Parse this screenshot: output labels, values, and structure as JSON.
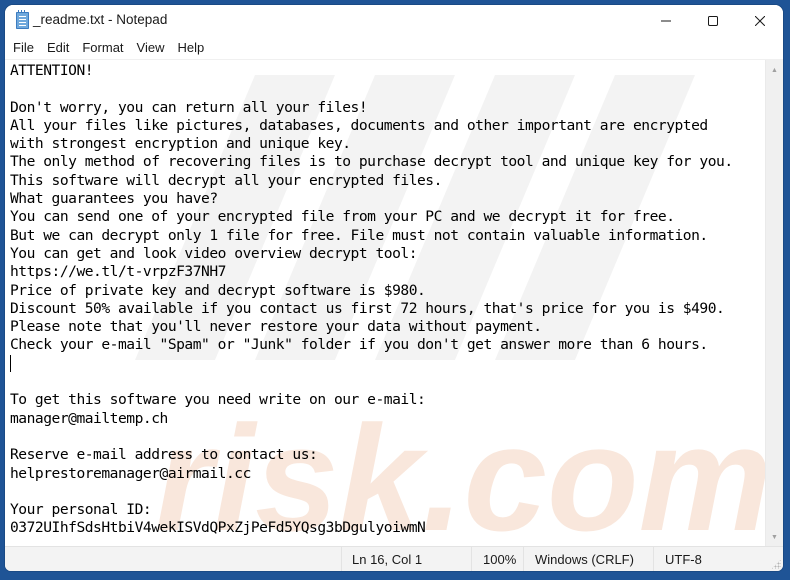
{
  "window": {
    "title": "_readme.txt - Notepad",
    "app_icon": "notepad-icon",
    "controls": {
      "minimize": "minimize-icon",
      "maximize": "maximize-icon",
      "close": "close-icon"
    }
  },
  "menu": {
    "items": [
      {
        "label": "File"
      },
      {
        "label": "Edit"
      },
      {
        "label": "Format"
      },
      {
        "label": "View"
      },
      {
        "label": "Help"
      }
    ]
  },
  "document": {
    "lines": [
      "ATTENTION!",
      "",
      "Don't worry, you can return all your files!",
      "All your files like pictures, databases, documents and other important are encrypted",
      "with strongest encryption and unique key.",
      "The only method of recovering files is to purchase decrypt tool and unique key for you.",
      "This software will decrypt all your encrypted files.",
      "What guarantees you have?",
      "You can send one of your encrypted file from your PC and we decrypt it for free.",
      "But we can decrypt only 1 file for free. File must not contain valuable information.",
      "You can get and look video overview decrypt tool:",
      "https://we.tl/t-vrpzF37NH7",
      "Price of private key and decrypt software is $980.",
      "Discount 50% available if you contact us first 72 hours, that's price for you is $490.",
      "Please note that you'll never restore your data without payment.",
      "Check your e-mail \"Spam\" or \"Junk\" folder if you don't get answer more than 6 hours.",
      "",
      "",
      "To get this software you need write on our e-mail:",
      "manager@mailtemp.ch",
      "",
      "Reserve e-mail address to contact us:",
      "helprestoremanager@airmail.cc",
      "",
      "Your personal ID:",
      "0372UIhfSdsHtbiV4wekISVdQPxZjPeFd5YQsg3bDgulyoiwmN"
    ],
    "caret_line": 16,
    "watermark": "risk.com"
  },
  "statusbar": {
    "position": "Ln 16, Col 1",
    "zoom": "100%",
    "line_ending": "Windows (CRLF)",
    "encoding": "UTF-8"
  },
  "colors": {
    "desktop": "#1f5496",
    "window_bg": "#ffffff",
    "statusbar_bg": "#f3f3f3",
    "watermark": "#f7e6dc"
  }
}
